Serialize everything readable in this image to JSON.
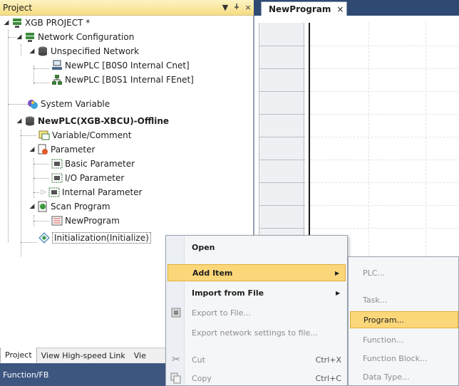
{
  "project_panel": {
    "title": "Project",
    "pin_glyph": "▾ ⊥",
    "close_glyph": "×",
    "tree": [
      {
        "label": "XGB PROJECT *",
        "icon": "project-icon",
        "bold": false
      },
      {
        "label": "Network Configuration",
        "icon": "network-icon",
        "bold": false
      },
      {
        "label": "Unspecified Network",
        "icon": "cylinder-icon",
        "bold": false
      },
      {
        "label": "NewPLC [B0S0 Internal Cnet]",
        "icon": "cnet-icon",
        "bold": false
      },
      {
        "label": "NewPLC [B0S1 Internal FEnet]",
        "icon": "fenet-icon",
        "bold": false
      },
      {
        "label": "System Variable",
        "icon": "system-variable-icon",
        "bold": false
      },
      {
        "label": "NewPLC(XGB-XBCU)-Offline",
        "icon": "plc-icon",
        "bold": true
      },
      {
        "label": "Variable/Comment",
        "icon": "variable-icon",
        "bold": false
      },
      {
        "label": "Parameter",
        "icon": "parameter-icon",
        "bold": false
      },
      {
        "label": "Basic Parameter",
        "icon": "basic-parameter-icon",
        "bold": false
      },
      {
        "label": "I/O Parameter",
        "icon": "io-parameter-icon",
        "bold": false
      },
      {
        "label": "Internal Parameter",
        "icon": "internal-parameter-icon",
        "bold": false
      },
      {
        "label": "Scan Program",
        "icon": "scan-program-icon",
        "bold": false
      },
      {
        "label": "NewProgram",
        "icon": "program-icon",
        "bold": false
      },
      {
        "label": "Initialization(Initialize)",
        "icon": "initialization-icon",
        "bold": false
      }
    ],
    "bottom_tabs": [
      "Project",
      "View High-speed Link",
      "Vie"
    ],
    "function_header": "Function/FB"
  },
  "editor": {
    "tab_label": "NewProgram",
    "tab_close": "×"
  },
  "context_menu": {
    "items": [
      {
        "label": "Open",
        "shortcut": "",
        "submenu": false
      },
      {
        "label": "Add Item",
        "shortcut": "",
        "submenu": true
      },
      {
        "label": "Import from File",
        "shortcut": "",
        "submenu": true
      },
      {
        "label": "Export to File...",
        "shortcut": "",
        "submenu": false
      },
      {
        "label": "Export network settings to file...",
        "shortcut": "",
        "submenu": false
      },
      {
        "label": "Cut",
        "shortcut": "Ctrl+X",
        "submenu": false
      },
      {
        "label": "Copy",
        "shortcut": "Ctrl+C",
        "submenu": false
      }
    ],
    "submenu_arrow": "▶"
  },
  "add_item_submenu": {
    "items": [
      "PLC...",
      "Task...",
      "Program...",
      "Function...",
      "Function Block...",
      "Data Type..."
    ]
  },
  "colors": {
    "header_gradient": "#f6dd83",
    "highlight": "#fbd77a",
    "tabbar": "#2f4a72"
  }
}
